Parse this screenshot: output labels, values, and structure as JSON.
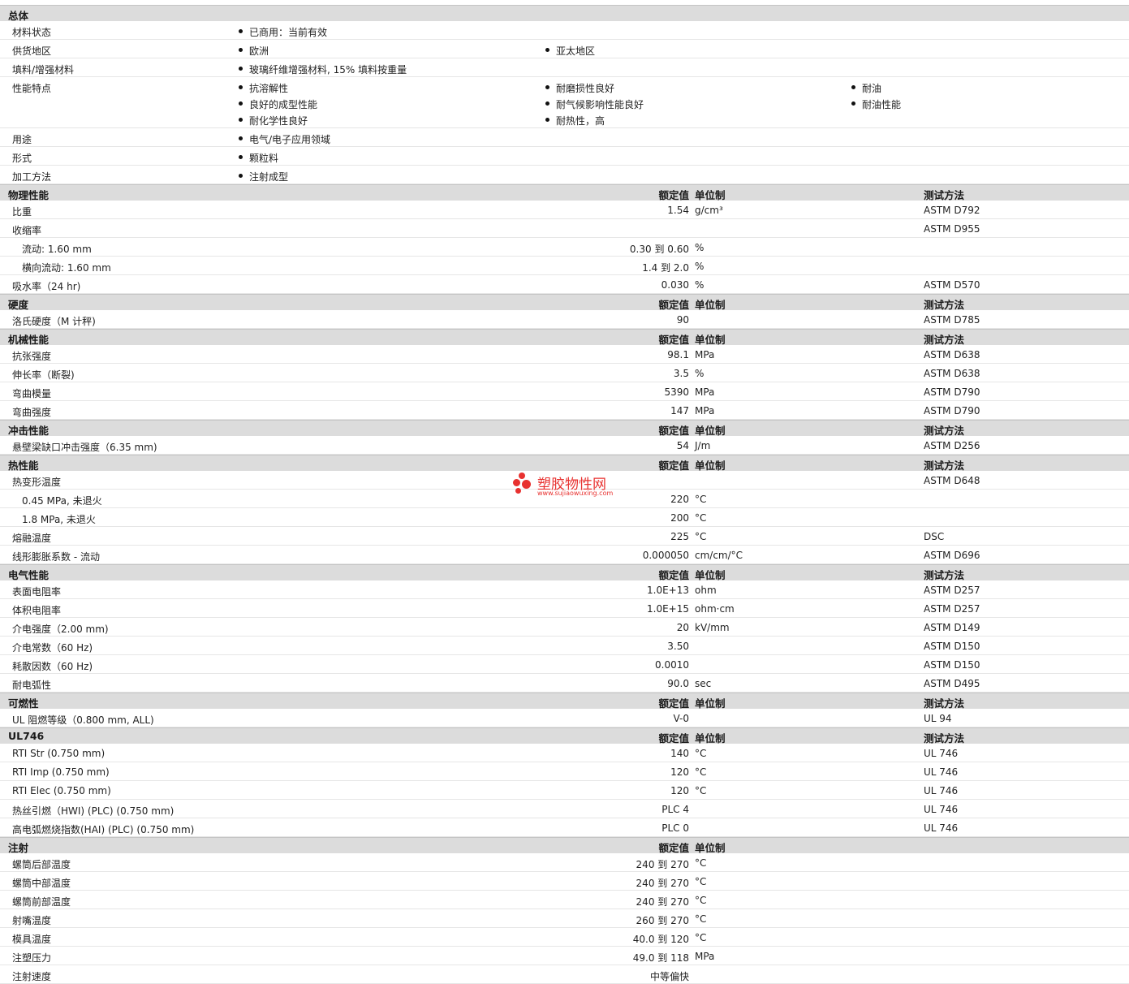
{
  "general": {
    "title": "总体",
    "rows": [
      {
        "label": "材料状态",
        "items": [
          "已商用：当前有效"
        ]
      },
      {
        "label": "供货地区",
        "items": [
          "欧洲",
          "亚太地区"
        ]
      },
      {
        "label": "填料/增强材料",
        "items": [
          "玻璃纤维增强材料, 15% 填料按重量"
        ]
      },
      {
        "label": "性能特点",
        "items": [
          "抗溶解性",
          "耐磨损性良好",
          "耐油",
          "良好的成型性能",
          "耐气候影响性能良好",
          "耐油性能",
          "耐化学性良好",
          "耐热性，高"
        ]
      },
      {
        "label": "用途",
        "items": [
          "电气/电子应用领域"
        ]
      },
      {
        "label": "形式",
        "items": [
          "颗粒料"
        ]
      },
      {
        "label": "加工方法",
        "items": [
          "注射成型"
        ]
      }
    ]
  },
  "header_labels": {
    "value": "额定值",
    "unit": "单位制",
    "method": "测试方法"
  },
  "sections": [
    {
      "title": "物理性能",
      "show_method": true,
      "rows": [
        {
          "label": "比重",
          "value": "1.54",
          "unit": "g/cm³",
          "method": "ASTM D792"
        },
        {
          "label": "收缩率",
          "value": "",
          "unit": "",
          "method": "ASTM D955"
        },
        {
          "label": "流动: 1.60 mm",
          "value": "0.30 到  0.60",
          "unit": "%",
          "method": "",
          "sub": true
        },
        {
          "label": "横向流动: 1.60 mm",
          "value": "1.4 到  2.0",
          "unit": "%",
          "method": "",
          "sub": true
        },
        {
          "label": "吸水率（24 hr)",
          "value": "0.030",
          "unit": "%",
          "method": "ASTM D570"
        }
      ]
    },
    {
      "title": "硬度",
      "show_method": true,
      "rows": [
        {
          "label": "洛氏硬度（M 计秤)",
          "value": "90",
          "unit": "",
          "method": "ASTM D785"
        }
      ]
    },
    {
      "title": "机械性能",
      "show_method": true,
      "rows": [
        {
          "label": "抗张强度",
          "value": "98.1",
          "unit": "MPa",
          "method": "ASTM D638"
        },
        {
          "label": "伸长率（断裂)",
          "value": "3.5",
          "unit": "%",
          "method": "ASTM D638"
        },
        {
          "label": "弯曲模量",
          "value": "5390",
          "unit": "MPa",
          "method": "ASTM D790"
        },
        {
          "label": "弯曲强度",
          "value": "147",
          "unit": "MPa",
          "method": "ASTM D790"
        }
      ]
    },
    {
      "title": "冲击性能",
      "show_method": true,
      "rows": [
        {
          "label": "悬壁梁缺口冲击强度（6.35 mm)",
          "value": "54",
          "unit": "J/m",
          "method": "ASTM D256"
        }
      ]
    },
    {
      "title": "热性能",
      "show_method": true,
      "rows": [
        {
          "label": "热变形温度",
          "value": "",
          "unit": "",
          "method": "ASTM D648"
        },
        {
          "label": "0.45 MPa, 未退火",
          "value": "220",
          "unit": "°C",
          "method": "",
          "sub": true
        },
        {
          "label": "1.8 MPa, 未退火",
          "value": "200",
          "unit": "°C",
          "method": "",
          "sub": true
        },
        {
          "label": "熔融温度",
          "value": "225",
          "unit": "°C",
          "method": "DSC"
        },
        {
          "label": "线形膨胀系数  - 流动",
          "value": "0.000050",
          "unit": "cm/cm/°C",
          "method": "ASTM D696"
        }
      ]
    },
    {
      "title": "电气性能",
      "show_method": true,
      "rows": [
        {
          "label": "表面电阻率",
          "value": "1.0E+13",
          "unit": "ohm",
          "method": "ASTM D257"
        },
        {
          "label": "体积电阻率",
          "value": "1.0E+15",
          "unit": "ohm·cm",
          "method": "ASTM D257"
        },
        {
          "label": "介电强度（2.00 mm)",
          "value": "20",
          "unit": "kV/mm",
          "method": "ASTM D149"
        },
        {
          "label": "介电常数（60 Hz)",
          "value": "3.50",
          "unit": "",
          "method": "ASTM D150"
        },
        {
          "label": "耗散因数（60 Hz)",
          "value": "0.0010",
          "unit": "",
          "method": "ASTM D150"
        },
        {
          "label": "耐电弧性",
          "value": "90.0",
          "unit": "sec",
          "method": "ASTM D495"
        }
      ]
    },
    {
      "title": "可燃性",
      "show_method": true,
      "rows": [
        {
          "label": "UL 阻燃等级（0.800 mm, ALL)",
          "value": "V-0",
          "unit": "",
          "method": "UL 94"
        }
      ]
    },
    {
      "title": "UL746",
      "show_method": true,
      "rows": [
        {
          "label": "RTI Str (0.750 mm)",
          "value": "140",
          "unit": "°C",
          "method": "UL 746"
        },
        {
          "label": "RTI Imp (0.750 mm)",
          "value": "120",
          "unit": "°C",
          "method": "UL 746"
        },
        {
          "label": "RTI Elec (0.750 mm)",
          "value": "120",
          "unit": "°C",
          "method": "UL 746"
        },
        {
          "label": "热丝引燃（HWI) (PLC) (0.750 mm)",
          "value": "PLC 4",
          "unit": "",
          "method": "UL 746"
        },
        {
          "label": "高电弧燃烧指数(HAI) (PLC) (0.750 mm)",
          "value": "PLC 0",
          "unit": "",
          "method": "UL 746"
        }
      ]
    },
    {
      "title": "注射",
      "show_method": false,
      "rows": [
        {
          "label": "螺筒后部温度",
          "value": "240 到  270",
          "unit": "°C",
          "method": ""
        },
        {
          "label": "螺筒中部温度",
          "value": "240 到  270",
          "unit": "°C",
          "method": ""
        },
        {
          "label": "螺筒前部温度",
          "value": "240 到  270",
          "unit": "°C",
          "method": ""
        },
        {
          "label": "射嘴温度",
          "value": "260 到  270",
          "unit": "°C",
          "method": ""
        },
        {
          "label": "模具温度",
          "value": "40.0 到  120",
          "unit": "°C",
          "method": ""
        },
        {
          "label": "注塑压力",
          "value": "49.0 到  118",
          "unit": "MPa",
          "method": ""
        },
        {
          "label": "注射速度",
          "value": "中等偏快",
          "unit": "",
          "method": ""
        }
      ]
    }
  ],
  "watermark": {
    "text": "塑胶物性网",
    "url": "www.sujiaowuxing.com",
    "color": "#e8312f"
  }
}
